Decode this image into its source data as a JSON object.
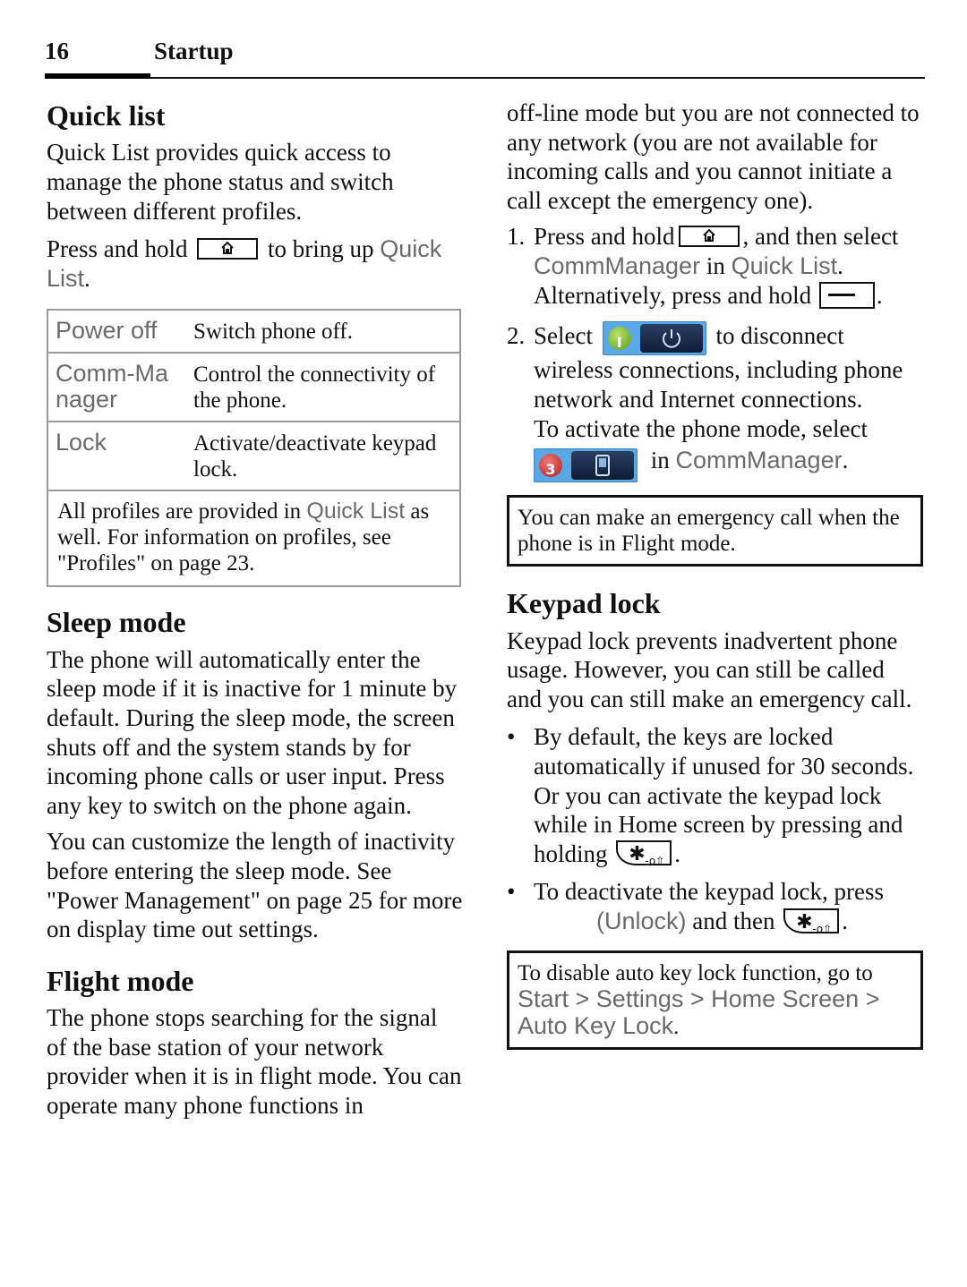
{
  "header": {
    "page_number": "16",
    "chapter": "Startup"
  },
  "quick_list": {
    "title": "Quick list",
    "intro": "Quick List provides quick access to manage the phone status and switch between different profiles.",
    "press_pre": "Press and hold",
    "press_post": "to bring up",
    "press_ui": "Quick List",
    "press_end": ".",
    "key_icon": "home-key-icon",
    "table": [
      {
        "term": "Power off",
        "desc": "Switch phone off."
      },
      {
        "term": "Comm-Manager",
        "desc": "Control the connectivity of the phone."
      },
      {
        "term": "Lock",
        "desc": "Activate/deactivate keypad lock."
      }
    ],
    "note_pre": "All profiles are provided in",
    "note_ui": "Quick List",
    "note_post": "as well. For information on profiles, see \"Profiles\" on page 23."
  },
  "sleep_mode": {
    "title": "Sleep mode",
    "para1": "The phone will automatically enter the sleep mode if it is inactive for 1 minute by default. During the sleep mode, the screen shuts off and the system stands by for incoming phone calls or user input. Press any key to switch on the phone again.",
    "para2": "You can customize the length of inactivity before entering the sleep mode. See \"Power Management\" on page 25 for more on display time out settings."
  },
  "flight_mode": {
    "title": "Flight mode",
    "para1": "The phone stops searching for the signal of the base station of your network provider when it is in flight mode. You can operate many phone functions in",
    "para1_cont": "off-line mode but you are not connected to any network (you are not available for incoming calls and you cannot initiate a call except the emergency one).",
    "steps": [
      {
        "num": "1.",
        "pre": "Press and hold",
        "mid": ", and then select",
        "ui1": "CommManager",
        "in": "in",
        "ui2": "Quick List",
        "end": ".",
        "alt": "Alternatively, press and hold",
        "alt_end": "."
      },
      {
        "num": "2.",
        "pre": "Select",
        "post": "to disconnect wireless connections, including phone network and Internet connections.",
        "activate": "To activate the phone mode, select",
        "in": "in",
        "ui": "CommManager",
        "end": "."
      }
    ],
    "widget_off_icon": "power-off-toggle-icon",
    "widget_on_icon": "phone-mode-toggle-icon",
    "note": "You can make an emergency call when the phone is in Flight mode."
  },
  "keypad_lock": {
    "title": "Keypad lock",
    "intro": "Keypad lock prevents inadvertent phone usage. However, you can still be called and you can still make an emergency call.",
    "bullets": [
      {
        "text": "By default, the keys are locked automatically if unused for 30 seconds.",
        "text2": "Or you can activate the keypad lock while in Home screen by pressing and holding",
        "end": "."
      },
      {
        "text": "To deactivate the keypad lock, press",
        "ui": "(Unlock)",
        "mid": "and then",
        "end": "."
      }
    ],
    "note_pre": "To disable auto key lock function, go to",
    "note_path": "Start > Settings > Home Screen > Auto Key Lock",
    "note_end": "."
  }
}
